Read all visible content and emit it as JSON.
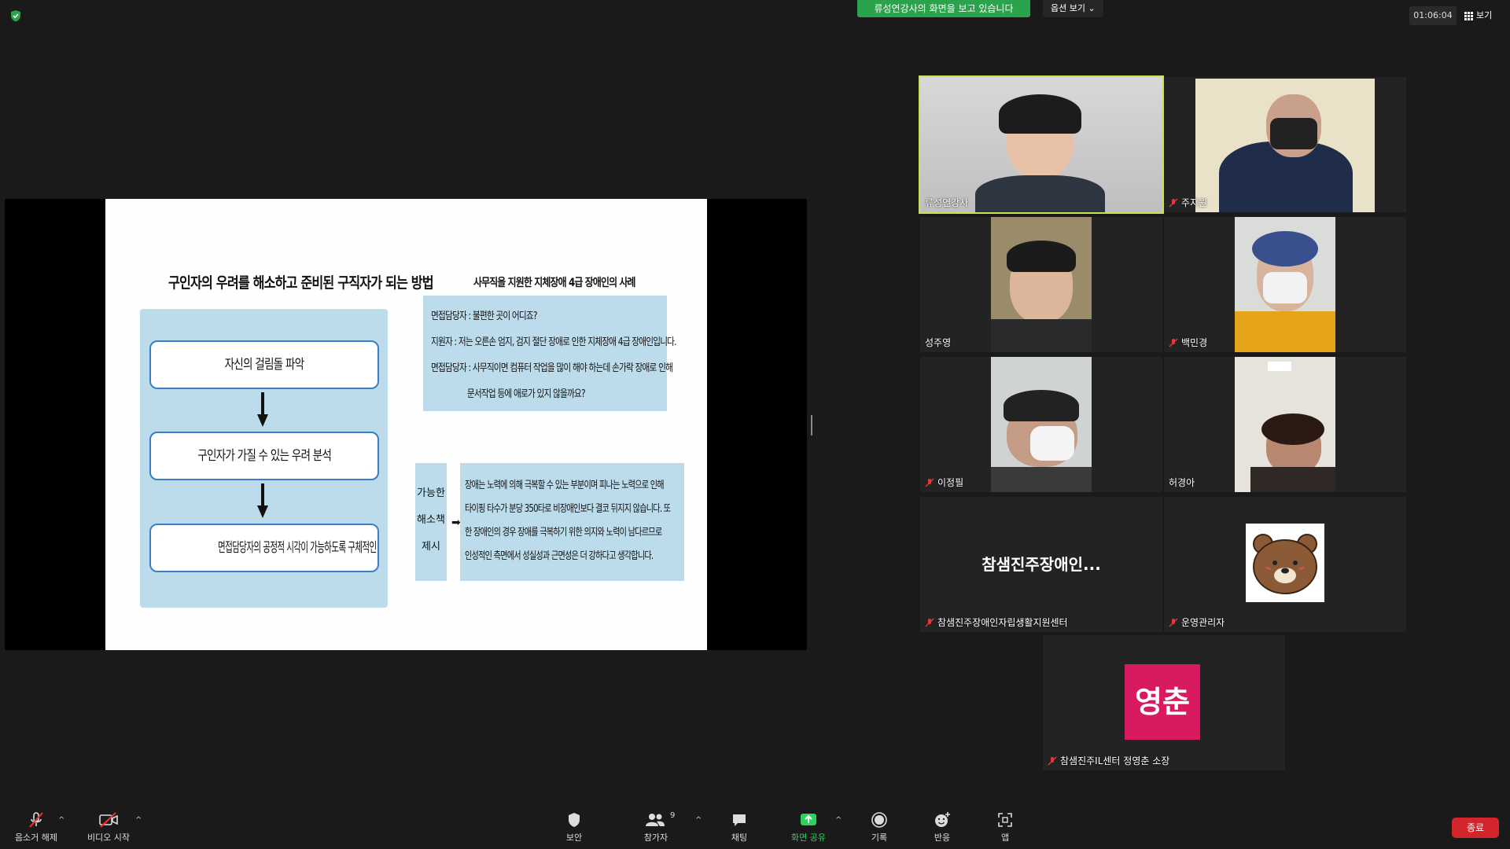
{
  "top": {
    "banner": "류성연강사의 화면을 보고 있습니다",
    "view_options": "옵션 보기 ⌄",
    "timer": "01:06:04",
    "view_label": "보기"
  },
  "slide": {
    "left_title": "구인자의 우려를 해소하고 준비된 구직자가 되는 방법",
    "steps": [
      "자신의 걸림돌 파악",
      "구인자가 가질 수 있는 우려 분석",
      "면접담당자의 공정적 시각이 가능하도록 구체적인 해소책(대안) 제시"
    ],
    "right_title": "사무직을 지원한 지체장애 4급 장애인의 사례",
    "qa": [
      "면접담당자 : 불편한 곳이 어디죠?",
      "지원자 : 저는 오른손 엄지, 검지 절단 장애로 인한 지체장애 4급 장애인입니다.",
      "면접담당자 : 사무직이면 컴퓨터 작업을 많이 해야 하는데 손가락 장애로 인해",
      "문서작업 등에 애로가 있지 않을까요?"
    ],
    "solution_label": [
      "가능한",
      "해소책",
      "제시"
    ],
    "solution_arrow": "➡",
    "solution_text": [
      "장애는 노력에 의해 극복할 수 있는 부분이며 피나는 노력으로 인해",
      "타이핑 타수가 분당 350타로 비장애인보다 결코 뒤지지 않습니다. 또",
      "한 장애인의 경우 장애를 극복하기 위한 의지와 노력이 남다르므로",
      "인성적인 측면에서 성실성과 근면성은 더 강하다고 생각합니다."
    ]
  },
  "participants": [
    {
      "name": "류성연강사",
      "muted": false,
      "active": true
    },
    {
      "name": "주지원",
      "muted": true
    },
    {
      "name": "성주영",
      "muted": false
    },
    {
      "name": "백민경",
      "muted": true
    },
    {
      "name": "이정필",
      "muted": true
    },
    {
      "name": "허경아",
      "muted": false
    },
    {
      "name": "참샘진주장애인자립생활지원센터",
      "muted": true,
      "display": "참샘진주장애인..."
    },
    {
      "name": "운영관리자",
      "muted": true
    },
    {
      "name": "참샘진주IL센터 정영춘 소장",
      "muted": true,
      "avatar_text": "영춘"
    }
  ],
  "toolbar": {
    "unmute": "음소거 해제",
    "start_video": "비디오 시작",
    "security": "보안",
    "participants": "참가자",
    "participants_count": "9",
    "chat": "채팅",
    "share_screen": "화면 공유",
    "record": "기록",
    "reactions": "반응",
    "apps": "앱",
    "end": "종료"
  },
  "colors": {
    "share_green": "#2ba24c",
    "active_border": "#c6e355",
    "end_red": "#d4242c",
    "slide_box": "#bcdcec",
    "avatar_pink": "#d81b60"
  }
}
